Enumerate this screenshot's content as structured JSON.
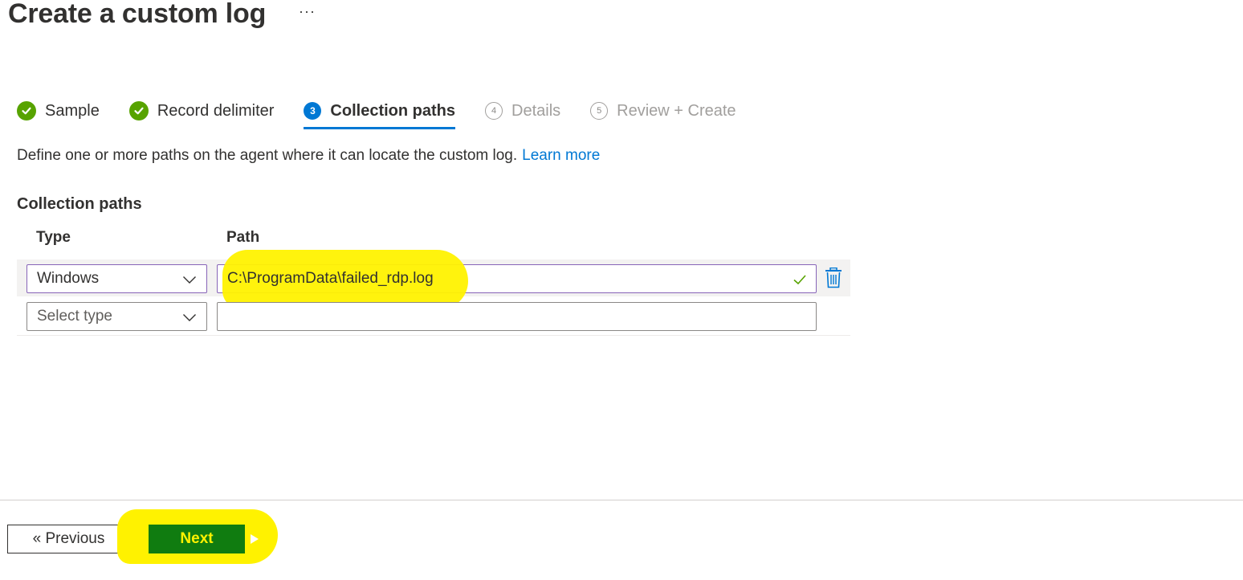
{
  "header": {
    "title": "Create a custom log",
    "more_label": "···"
  },
  "steps": [
    {
      "label": "Sample",
      "state": "done"
    },
    {
      "label": "Record delimiter",
      "state": "done"
    },
    {
      "number": "3",
      "label": "Collection paths",
      "state": "active"
    },
    {
      "number": "4",
      "label": "Details",
      "state": "pending"
    },
    {
      "number": "5",
      "label": "Review + Create",
      "state": "pending"
    }
  ],
  "description": {
    "text": "Define one or more paths on the agent where it can locate the custom log.",
    "link": "Learn more"
  },
  "section": {
    "title": "Collection paths"
  },
  "table": {
    "columns": [
      "Type",
      "Path"
    ],
    "rows": [
      {
        "type": "Windows",
        "path": "C:\\ProgramData\\failed_rdp.log"
      },
      {
        "type_placeholder": "Select type",
        "path": ""
      }
    ]
  },
  "footer": {
    "previous_label": "« Previous",
    "next_label": "Next"
  },
  "colors": {
    "accent": "#0078d4",
    "success": "#57a300",
    "next_bg": "#107c10",
    "highlight": "#fff200"
  }
}
